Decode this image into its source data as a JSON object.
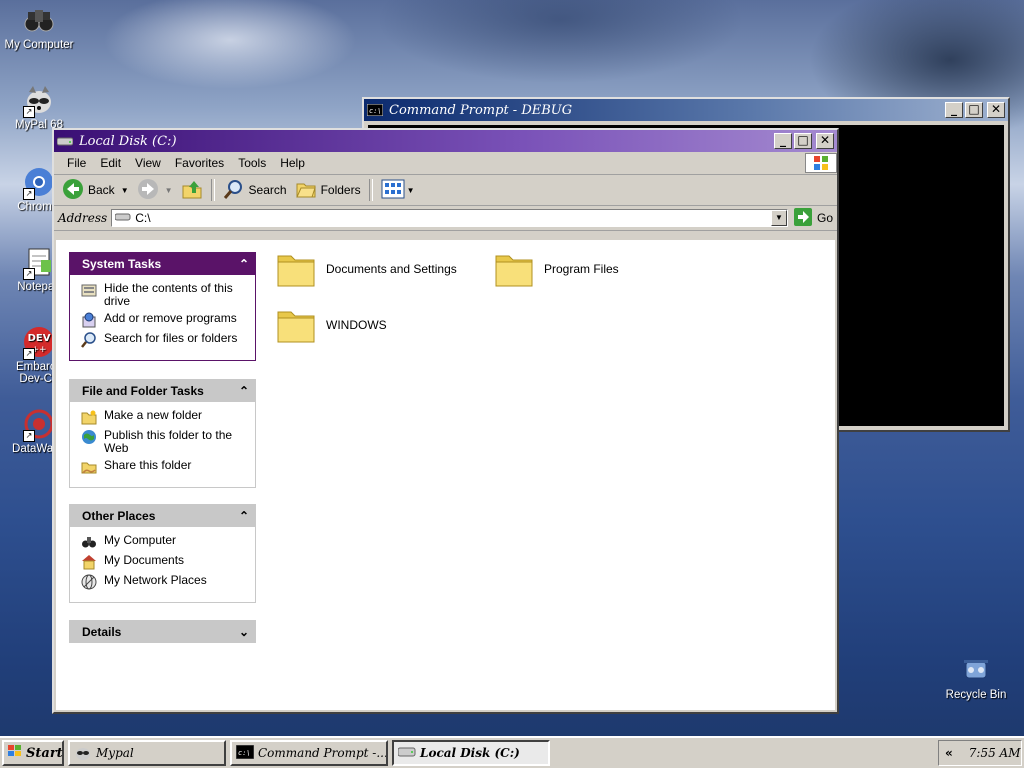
{
  "desktop": {
    "icons": [
      {
        "label": "My Computer",
        "icon": "binoculars-icon"
      },
      {
        "label": "MyPal 68",
        "icon": "raccoon-icon"
      },
      {
        "label": "Chromiu",
        "icon": "chromium-icon"
      },
      {
        "label": "Notepad",
        "icon": "notepad-icon"
      },
      {
        "label": "Embarca",
        "label2": "Dev-C+",
        "icon": "devcpp-icon"
      },
      {
        "label": "DataWage",
        "icon": "datawage-icon"
      }
    ],
    "recycle_bin": {
      "label": "Recycle Bin",
      "icon": "recycle-bin-icon"
    }
  },
  "cmd_window": {
    "title": "Command Prompt - DEBUG",
    "min": "_",
    "max": "□",
    "close": "✕"
  },
  "explorer": {
    "title": "Local Disk (C:)",
    "min": "_",
    "max": "□",
    "close": "✕",
    "menu": [
      "File",
      "Edit",
      "View",
      "Favorites",
      "Tools",
      "Help"
    ],
    "toolbar": {
      "back": "Back",
      "search": "Search",
      "folders": "Folders"
    },
    "address": {
      "label": "Address",
      "value": "C:\\",
      "go": "Go"
    },
    "panels": {
      "system_tasks": {
        "title": "System Tasks",
        "collapse": "⌃",
        "items": [
          "Hide the contents of this drive",
          "Add or remove programs",
          "Search for files or folders"
        ]
      },
      "file_folder_tasks": {
        "title": "File and Folder Tasks",
        "collapse": "⌃",
        "items": [
          "Make a new folder",
          "Publish this folder to the Web",
          "Share this folder"
        ]
      },
      "other_places": {
        "title": "Other Places",
        "collapse": "⌃",
        "items": [
          "My Computer",
          "My Documents",
          "My Network Places"
        ]
      },
      "details": {
        "title": "Details",
        "expand": "⌄"
      }
    },
    "folders": [
      "Documents and Settings",
      "Program Files",
      "WINDOWS"
    ]
  },
  "taskbar": {
    "start": "Start",
    "tasks": [
      {
        "label": "Mypal",
        "active": false
      },
      {
        "label": "Command Prompt -...",
        "active": false
      },
      {
        "label": "Local Disk (C:)",
        "active": true
      }
    ],
    "tray_chevron": "«",
    "clock": "7:55 AM"
  },
  "colors": {
    "active_title": "#3a0f74",
    "panel_special": "#5a1368",
    "window_face": "#d4d0c8"
  }
}
